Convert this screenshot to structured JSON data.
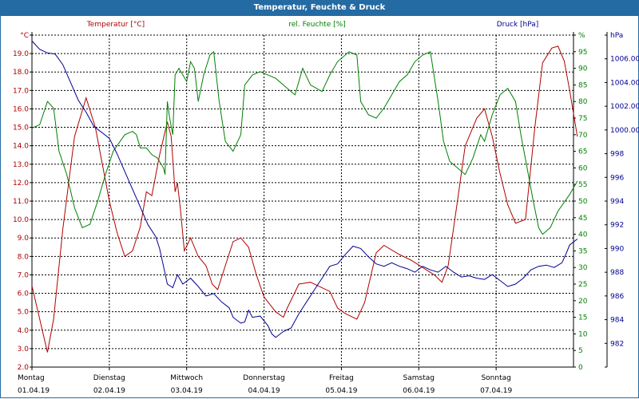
{
  "window": {
    "title": "Temperatur, Feuchte & Druck"
  },
  "chart_data": {
    "type": "line",
    "title": "Temperatur, Feuchte & Druck",
    "x_days": [
      {
        "weekday": "Montag",
        "date": "01.04.19"
      },
      {
        "weekday": "Dienstag",
        "date": "02.04.19"
      },
      {
        "weekday": "Mittwoch",
        "date": "03.04.19"
      },
      {
        "weekday": "Donnerstag",
        "date": "04.04.19"
      },
      {
        "weekday": "Freitag",
        "date": "05.04.19"
      },
      {
        "weekday": "Samstag",
        "date": "06.04.19"
      },
      {
        "weekday": "Sonntag",
        "date": "07.04.19"
      }
    ],
    "axes": {
      "temperature": {
        "label": "Temperatur [°C]",
        "unit": "°C",
        "min": 2.0,
        "max": 20.0,
        "step": 1.0,
        "decimals": 1,
        "color": "#b00000",
        "side": "left"
      },
      "humidity": {
        "label": "rel. Feuchte [%]",
        "unit": "%",
        "min": 0,
        "max": 100,
        "step": 5,
        "decimals": 0,
        "color": "#008000",
        "side": "right"
      },
      "pressure": {
        "label": "Druck [hPa]",
        "unit": "hPa",
        "min": 980,
        "max": 1008,
        "step": 2,
        "decimals": 3,
        "color": "#000090",
        "side": "right-outer"
      }
    },
    "grid": true,
    "series": [
      {
        "name": "Temperatur [°C]",
        "axis": "temperature",
        "color": "#b00000",
        "points": [
          [
            0.0,
            6.4
          ],
          [
            0.1,
            4.6
          ],
          [
            0.2,
            2.8
          ],
          [
            0.28,
            4.6
          ],
          [
            0.4,
            9.5
          ],
          [
            0.55,
            14.5
          ],
          [
            0.7,
            16.6
          ],
          [
            0.82,
            15.0
          ],
          [
            1.0,
            11.0
          ],
          [
            1.1,
            9.3
          ],
          [
            1.2,
            8.0
          ],
          [
            1.3,
            8.3
          ],
          [
            1.4,
            9.6
          ],
          [
            1.48,
            11.5
          ],
          [
            1.55,
            11.3
          ],
          [
            1.65,
            13.5
          ],
          [
            1.75,
            15.3
          ],
          [
            1.8,
            14.5
          ],
          [
            1.85,
            11.5
          ],
          [
            1.88,
            12.0
          ],
          [
            1.92,
            10.5
          ],
          [
            1.97,
            8.3
          ],
          [
            2.05,
            9.0
          ],
          [
            2.15,
            8.0
          ],
          [
            2.25,
            7.5
          ],
          [
            2.33,
            6.5
          ],
          [
            2.4,
            6.2
          ],
          [
            2.5,
            7.5
          ],
          [
            2.6,
            8.8
          ],
          [
            2.7,
            9.0
          ],
          [
            2.8,
            8.5
          ],
          [
            2.9,
            7.0
          ],
          [
            3.0,
            5.8
          ],
          [
            3.15,
            5.0
          ],
          [
            3.25,
            4.7
          ],
          [
            3.3,
            5.2
          ],
          [
            3.45,
            6.5
          ],
          [
            3.6,
            6.6
          ],
          [
            3.7,
            6.4
          ],
          [
            3.85,
            6.1
          ],
          [
            3.95,
            5.2
          ],
          [
            4.05,
            4.9
          ],
          [
            4.2,
            4.6
          ],
          [
            4.3,
            5.5
          ],
          [
            4.45,
            8.2
          ],
          [
            4.55,
            8.6
          ],
          [
            4.75,
            8.1
          ],
          [
            4.9,
            7.8
          ],
          [
            5.05,
            7.4
          ],
          [
            5.2,
            7.0
          ],
          [
            5.3,
            6.6
          ],
          [
            5.38,
            7.5
          ],
          [
            5.5,
            11.0
          ],
          [
            5.6,
            14.0
          ],
          [
            5.75,
            15.5
          ],
          [
            5.85,
            16.0
          ],
          [
            5.95,
            14.5
          ],
          [
            6.05,
            12.5
          ],
          [
            6.15,
            10.8
          ],
          [
            6.25,
            9.8
          ],
          [
            6.38,
            10.0
          ],
          [
            6.5,
            15.0
          ],
          [
            6.6,
            18.5
          ],
          [
            6.72,
            19.3
          ],
          [
            6.8,
            19.4
          ],
          [
            6.88,
            18.6
          ],
          [
            6.95,
            17.0
          ],
          [
            7.05,
            14.5
          ]
        ]
      },
      {
        "name": "rel. Feuchte [%]",
        "axis": "humidity",
        "color": "#008000",
        "points": [
          [
            0.0,
            72
          ],
          [
            0.1,
            73
          ],
          [
            0.2,
            80
          ],
          [
            0.28,
            78
          ],
          [
            0.35,
            65
          ],
          [
            0.45,
            58
          ],
          [
            0.55,
            48
          ],
          [
            0.65,
            42
          ],
          [
            0.75,
            43
          ],
          [
            0.85,
            50
          ],
          [
            0.95,
            58
          ],
          [
            1.05,
            65
          ],
          [
            1.2,
            70
          ],
          [
            1.3,
            71
          ],
          [
            1.35,
            70
          ],
          [
            1.4,
            66
          ],
          [
            1.48,
            66
          ],
          [
            1.55,
            64
          ],
          [
            1.62,
            63
          ],
          [
            1.7,
            60
          ],
          [
            1.72,
            58
          ],
          [
            1.75,
            80
          ],
          [
            1.78,
            75
          ],
          [
            1.82,
            70
          ],
          [
            1.85,
            88
          ],
          [
            1.9,
            90
          ],
          [
            1.95,
            88
          ],
          [
            2.0,
            86
          ],
          [
            2.05,
            92
          ],
          [
            2.1,
            90
          ],
          [
            2.15,
            80
          ],
          [
            2.22,
            88
          ],
          [
            2.3,
            94
          ],
          [
            2.35,
            95
          ],
          [
            2.42,
            80
          ],
          [
            2.5,
            68
          ],
          [
            2.6,
            65
          ],
          [
            2.7,
            70
          ],
          [
            2.75,
            85
          ],
          [
            2.85,
            88
          ],
          [
            2.95,
            89
          ],
          [
            3.05,
            88
          ],
          [
            3.15,
            87
          ],
          [
            3.3,
            84
          ],
          [
            3.4,
            82
          ],
          [
            3.5,
            90
          ],
          [
            3.6,
            85
          ],
          [
            3.75,
            83
          ],
          [
            3.85,
            88
          ],
          [
            3.95,
            92
          ],
          [
            4.1,
            95
          ],
          [
            4.2,
            94
          ],
          [
            4.25,
            80
          ],
          [
            4.35,
            76
          ],
          [
            4.45,
            75
          ],
          [
            4.55,
            78
          ],
          [
            4.65,
            82
          ],
          [
            4.75,
            86
          ],
          [
            4.85,
            88
          ],
          [
            4.95,
            92
          ],
          [
            5.05,
            94
          ],
          [
            5.15,
            95
          ],
          [
            5.25,
            80
          ],
          [
            5.32,
            68
          ],
          [
            5.4,
            62
          ],
          [
            5.5,
            60
          ],
          [
            5.6,
            58
          ],
          [
            5.7,
            63
          ],
          [
            5.8,
            70
          ],
          [
            5.85,
            68
          ],
          [
            5.95,
            76
          ],
          [
            6.05,
            82
          ],
          [
            6.15,
            84
          ],
          [
            6.25,
            80
          ],
          [
            6.32,
            70
          ],
          [
            6.4,
            60
          ],
          [
            6.48,
            50
          ],
          [
            6.55,
            42
          ],
          [
            6.6,
            40
          ],
          [
            6.7,
            42
          ],
          [
            6.8,
            47
          ],
          [
            6.95,
            52
          ],
          [
            7.05,
            56
          ]
        ]
      },
      {
        "name": "Druck [hPa]",
        "axis": "pressure",
        "color": "#000090",
        "points": [
          [
            0.0,
            1007.5
          ],
          [
            0.1,
            1006.8
          ],
          [
            0.2,
            1006.5
          ],
          [
            0.3,
            1006.4
          ],
          [
            0.4,
            1005.5
          ],
          [
            0.5,
            1004.0
          ],
          [
            0.6,
            1002.5
          ],
          [
            0.7,
            1001.5
          ],
          [
            0.8,
            1000.3
          ],
          [
            0.9,
            999.8
          ],
          [
            1.0,
            999.3
          ],
          [
            1.1,
            998.0
          ],
          [
            1.2,
            996.5
          ],
          [
            1.3,
            995.0
          ],
          [
            1.4,
            993.5
          ],
          [
            1.5,
            992.0
          ],
          [
            1.6,
            991.0
          ],
          [
            1.65,
            990.0
          ],
          [
            1.7,
            988.5
          ],
          [
            1.75,
            987.0
          ],
          [
            1.82,
            986.7
          ],
          [
            1.88,
            987.8
          ],
          [
            1.95,
            987.0
          ],
          [
            2.05,
            987.5
          ],
          [
            2.15,
            986.8
          ],
          [
            2.25,
            986.0
          ],
          [
            2.35,
            986.2
          ],
          [
            2.45,
            985.5
          ],
          [
            2.55,
            985.0
          ],
          [
            2.6,
            984.2
          ],
          [
            2.7,
            983.7
          ],
          [
            2.75,
            983.8
          ],
          [
            2.8,
            984.8
          ],
          [
            2.85,
            984.2
          ],
          [
            2.95,
            984.3
          ],
          [
            3.05,
            983.5
          ],
          [
            3.1,
            982.8
          ],
          [
            3.15,
            982.5
          ],
          [
            3.25,
            983.0
          ],
          [
            3.35,
            983.3
          ],
          [
            3.45,
            984.5
          ],
          [
            3.55,
            985.5
          ],
          [
            3.65,
            986.5
          ],
          [
            3.75,
            987.5
          ],
          [
            3.85,
            988.5
          ],
          [
            3.95,
            988.7
          ],
          [
            4.05,
            989.5
          ],
          [
            4.15,
            990.2
          ],
          [
            4.25,
            990.0
          ],
          [
            4.35,
            989.3
          ],
          [
            4.45,
            988.7
          ],
          [
            4.55,
            988.5
          ],
          [
            4.65,
            988.8
          ],
          [
            4.75,
            988.5
          ],
          [
            4.85,
            988.3
          ],
          [
            4.95,
            988.0
          ],
          [
            5.05,
            988.5
          ],
          [
            5.15,
            988.2
          ],
          [
            5.25,
            988.0
          ],
          [
            5.35,
            988.5
          ],
          [
            5.45,
            988.0
          ],
          [
            5.55,
            987.6
          ],
          [
            5.65,
            987.7
          ],
          [
            5.75,
            987.5
          ],
          [
            5.85,
            987.4
          ],
          [
            5.95,
            987.8
          ],
          [
            6.05,
            987.3
          ],
          [
            6.15,
            986.8
          ],
          [
            6.25,
            987.0
          ],
          [
            6.35,
            987.5
          ],
          [
            6.45,
            988.2
          ],
          [
            6.55,
            988.5
          ],
          [
            6.65,
            988.6
          ],
          [
            6.75,
            988.4
          ],
          [
            6.85,
            988.8
          ],
          [
            6.9,
            989.5
          ],
          [
            6.95,
            990.3
          ],
          [
            7.05,
            990.8
          ]
        ]
      }
    ]
  }
}
